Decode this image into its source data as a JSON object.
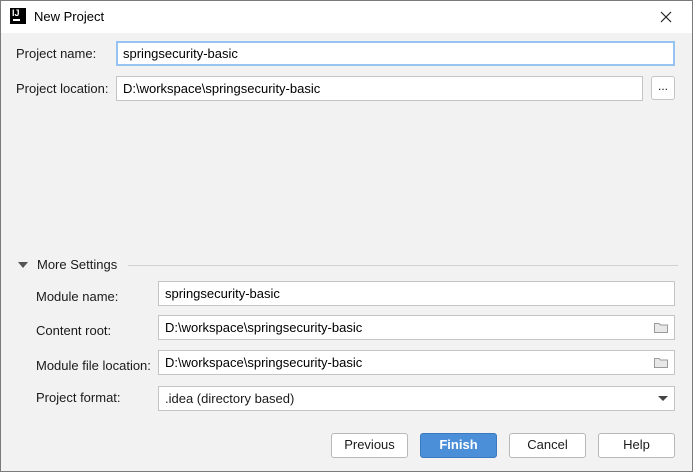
{
  "window": {
    "title": "New Project"
  },
  "form": {
    "project_name_label": "Project name:",
    "project_name_value": "springsecurity-basic",
    "project_location_label": "Project location:",
    "project_location_value": "D:\\workspace\\springsecurity-basic",
    "browse_label": "..."
  },
  "more_settings": {
    "header": "More Settings",
    "module_name_label": "Module name:",
    "module_name_value": "springsecurity-basic",
    "content_root_label": "Content root:",
    "content_root_value": "D:\\workspace\\springsecurity-basic",
    "module_file_location_label": "Module file location:",
    "module_file_location_value": "D:\\workspace\\springsecurity-basic",
    "project_format_label": "Project format:",
    "project_format_value": ".idea (directory based)"
  },
  "buttons": {
    "previous": "Previous",
    "finish": "Finish",
    "cancel": "Cancel",
    "help": "Help"
  },
  "colors": {
    "primary_button": "#4a8fd8",
    "focus_border": "#97c3f3",
    "dialog_background": "#f2f2f2"
  },
  "icons": {
    "app": "intellij-idea-icon",
    "close": "close-icon",
    "expand": "triangle-down-icon",
    "folder": "folder-icon",
    "dropdown": "chevron-down-icon"
  }
}
